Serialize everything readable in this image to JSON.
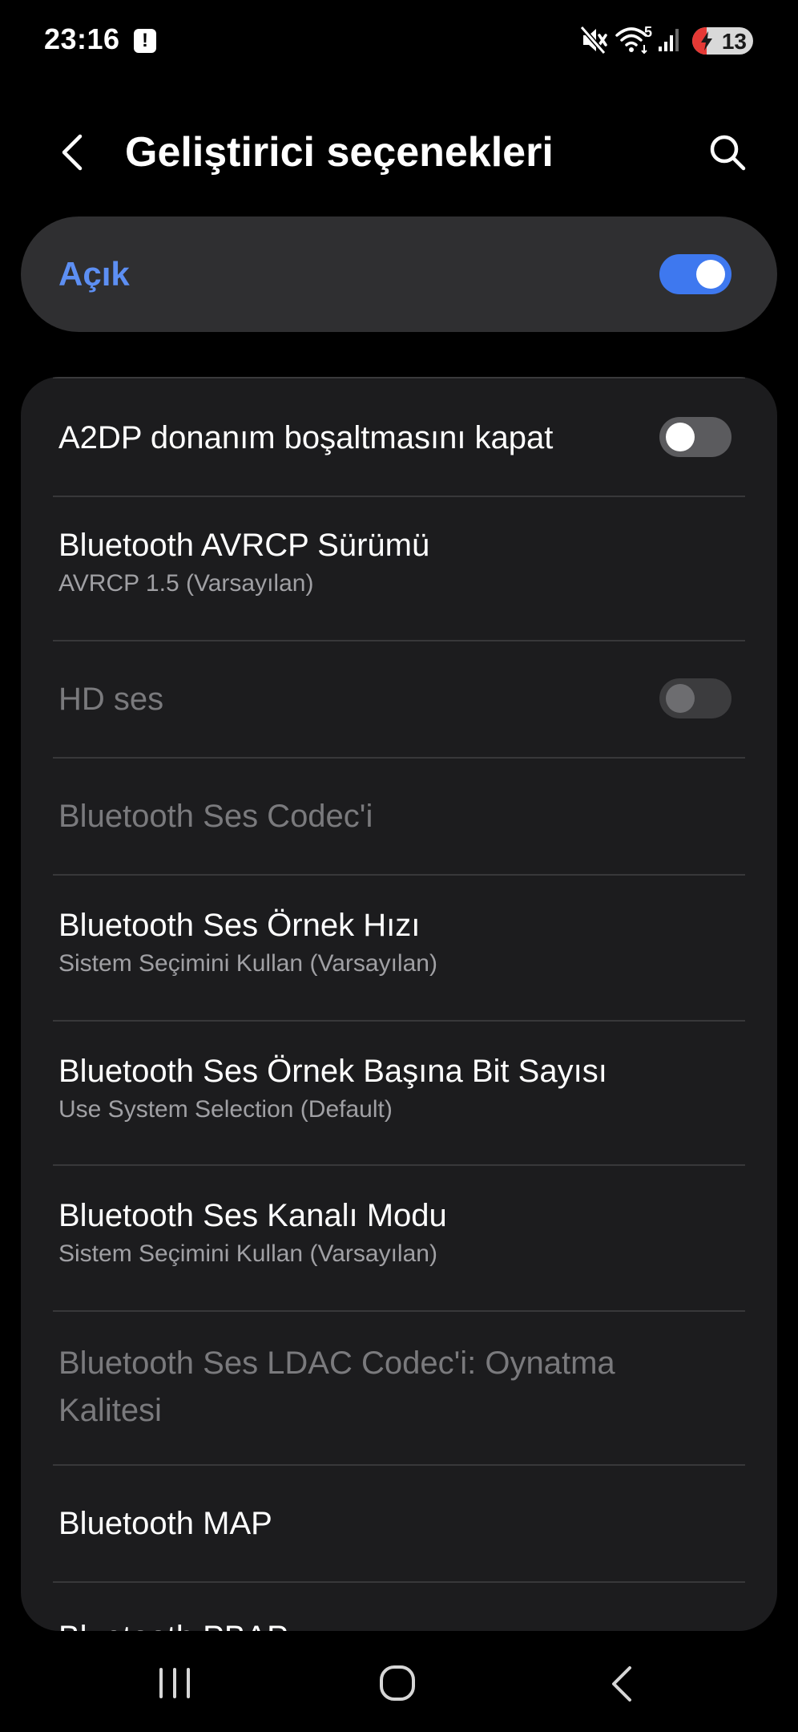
{
  "status_bar": {
    "time": "23:16",
    "alert_glyph": "!",
    "network_label": "5",
    "battery_level": "13",
    "icons": [
      "alert-icon",
      "mute-icon",
      "wifi-icon",
      "signal-icon",
      "battery-icon"
    ]
  },
  "header": {
    "title": "Geliştirici seçenekleri"
  },
  "master_toggle": {
    "label": "Açık",
    "on": true
  },
  "settings": {
    "items": [
      {
        "title": "A2DP donanım boşaltmasını kapat",
        "toggle": "off"
      },
      {
        "title": "Bluetooth AVRCP Sürümü",
        "subtitle": "AVRCP 1.5 (Varsayılan)"
      },
      {
        "title": "HD ses",
        "toggle": "disabled",
        "disabled": true
      },
      {
        "title": "Bluetooth Ses Codec'i",
        "disabled": true
      },
      {
        "title": "Bluetooth Ses Örnek Hızı",
        "subtitle": "Sistem Seçimini Kullan (Varsayılan)"
      },
      {
        "title": "Bluetooth Ses Örnek Başına Bit Sayısı",
        "subtitle": "Use System Selection (Default)"
      },
      {
        "title": "Bluetooth Ses Kanalı Modu",
        "subtitle": "Sistem Seçimini Kullan (Varsayılan)"
      },
      {
        "title_line1": "Bluetooth Ses LDAC Codec'i: Oynatma",
        "title_line2": "Kalitesi",
        "disabled": true
      },
      {
        "title": "Bluetooth MAP"
      },
      {
        "title": "Bluetooth PBAP"
      }
    ]
  },
  "colors": {
    "background": "#000000",
    "card": "#1c1c1e",
    "master_card": "#2f2f31",
    "accent": "#3e78ef",
    "accent_text": "#5d8ff3",
    "disabled_text": "#7a7a7d"
  },
  "nav_bar": {
    "icons": [
      "recents-icon",
      "home-icon",
      "back-icon"
    ]
  }
}
